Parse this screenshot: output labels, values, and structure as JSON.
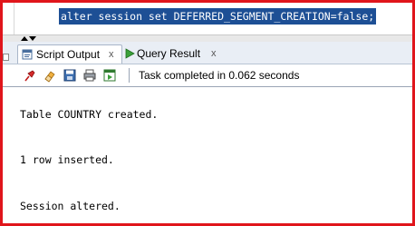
{
  "editor": {
    "sql_line": "alter session set DEFERRED_SEGMENT_CREATION=false;"
  },
  "tabs": [
    {
      "label": "Script Output",
      "close": "x",
      "icon": "script-output-icon",
      "active": true
    },
    {
      "label": "Query Result",
      "close": "x",
      "icon": "run-icon",
      "active": false
    }
  ],
  "toolbar": {
    "icons": [
      "pin-icon",
      "eraser-icon",
      "save-icon",
      "print-icon",
      "export-icon"
    ],
    "status": "Task completed in 0.062 seconds"
  },
  "output": {
    "lines": [
      "Table COUNTRY created.",
      "1 row inserted.",
      "Session altered."
    ]
  },
  "colors": {
    "highlight": "#1d4f95",
    "frame": "#e0151b"
  }
}
